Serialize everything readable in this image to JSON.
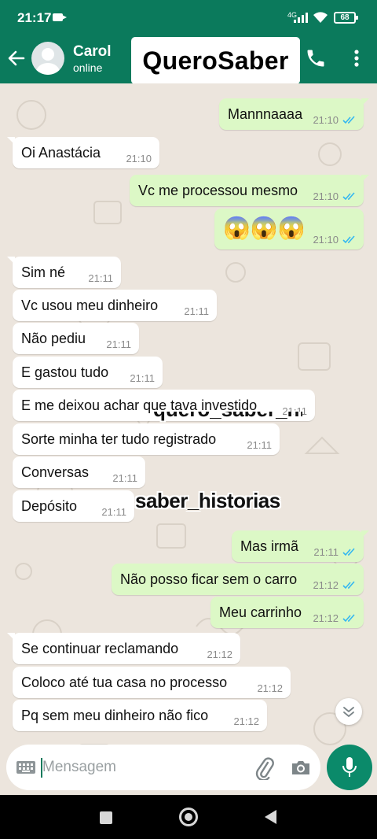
{
  "status_bar": {
    "time": "21:17",
    "network": "4G",
    "battery": "68"
  },
  "header": {
    "contact_name": "Carol",
    "contact_status": "online",
    "watermark": "QueroSaber"
  },
  "messages": [
    {
      "dir": "out",
      "text": "Mannnaaaa",
      "time": "21:10",
      "read": true
    },
    {
      "dir": "in",
      "text": "Oi Anastácia",
      "time": "21:10"
    },
    {
      "dir": "out",
      "text": "Vc me processou mesmo",
      "time": "21:10",
      "read": true
    },
    {
      "dir": "out",
      "text": "😱😱😱",
      "time": "21:10",
      "read": true
    },
    {
      "dir": "in",
      "text": "Sim né",
      "time": "21:11"
    },
    {
      "dir": "in",
      "text": "Vc usou meu dinheiro",
      "time": "21:11"
    },
    {
      "dir": "in",
      "text": "Não pediu",
      "time": "21:11"
    },
    {
      "dir": "in",
      "text": "E gastou tudo",
      "time": "21:11"
    },
    {
      "dir": "in",
      "text": "E me deixou achar que tava investido",
      "time": "21:11"
    },
    {
      "dir": "in",
      "text": "Sorte minha ter tudo registrado",
      "time": "21:11"
    },
    {
      "dir": "in",
      "text": "Conversas",
      "time": "21:11"
    },
    {
      "dir": "in",
      "text": "Depósito",
      "time": "21:11"
    },
    {
      "dir": "out",
      "text": "Mas irmã",
      "time": "21:11",
      "read": true
    },
    {
      "dir": "out",
      "text": "Não posso ficar sem o carro",
      "time": "21:12",
      "read": true
    },
    {
      "dir": "out",
      "text": "Meu carrinho",
      "time": "21:12",
      "read": true
    },
    {
      "dir": "in",
      "text": "Se continuar reclamando",
      "time": "21:12"
    },
    {
      "dir": "in",
      "text": "Coloco até tua casa no processo",
      "time": "21:12"
    },
    {
      "dir": "in",
      "text": "Pq sem meu dinheiro não fico",
      "time": "21:12"
    }
  ],
  "overlay": {
    "caption": "saber_historias",
    "clipped": "quero_saber_historias"
  },
  "composer": {
    "placeholder": "Mensagem"
  },
  "colors": {
    "header": "#0b7a5c",
    "outgoing": "#dcf8c6",
    "incoming": "#ffffff",
    "read_ticks": "#34b7f1",
    "chat_bg": "#ece5dd"
  }
}
